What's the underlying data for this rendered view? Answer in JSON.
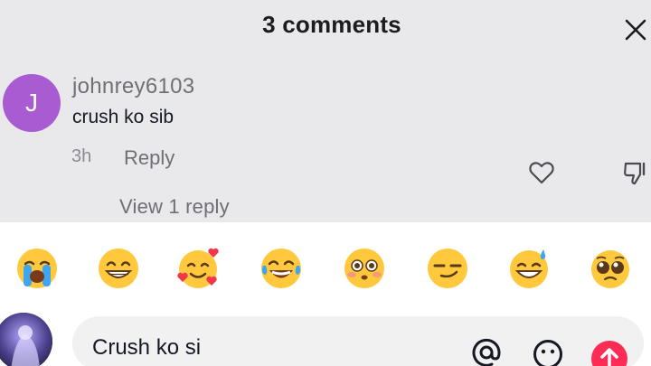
{
  "header": {
    "title": "3 comments",
    "close_icon": "close-icon"
  },
  "comment": {
    "avatar_letter": "J",
    "avatar_color": "#a95bd1",
    "username": "johnrey6103",
    "text": "crush ko sib",
    "time": "3h",
    "reply_label": "Reply",
    "view_replies_label": "View 1 reply",
    "like_icon": "heart-outline-icon",
    "dislike_icon": "thumbs-down-icon"
  },
  "emoji_bar": {
    "items": [
      "loudly-crying-face",
      "beaming-face",
      "smiling-face-with-hearts",
      "tears-of-joy",
      "flushed-face",
      "smirking-face",
      "grinning-sweat-face",
      "pleading-face"
    ]
  },
  "composer": {
    "input_value": "Crush ko si",
    "mention_icon": "at-sign-icon",
    "emoji_icon": "smiley-icon",
    "send_icon": "send-arrow-icon",
    "accent_color": "#fe2c55"
  }
}
